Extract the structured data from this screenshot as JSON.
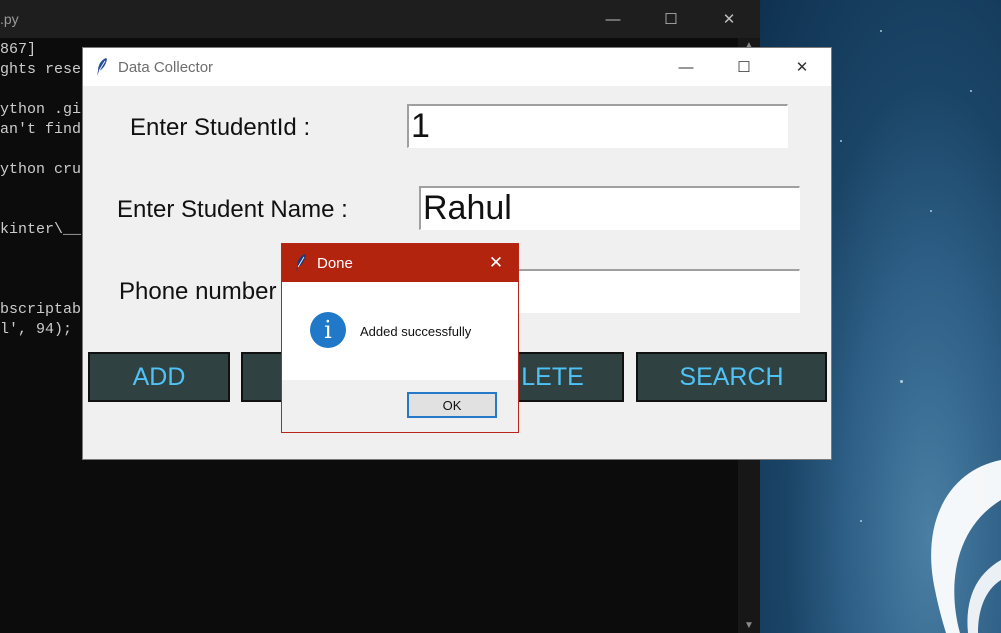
{
  "console": {
    "title": ".py",
    "lines": [
      "867]",
      "ghts rese",
      "",
      "ython .gi",
      "an't find",
      "",
      "ython cru",
      "",
      "",
      "kinter\\__",
      "",
      "",
      "",
      "bscriptab",
      "l', 94);"
    ],
    "minimize": "—",
    "maximize": "☐",
    "close": "✕"
  },
  "app": {
    "title": "Data Collector",
    "minimize": "—",
    "maximize": "☐",
    "close": "✕",
    "labels": {
      "student_id": "Enter StudentId :",
      "student_name": "Enter Student Name :",
      "phone": "Phone number"
    },
    "fields": {
      "student_id": "1",
      "student_name": "Rahul",
      "phone": ""
    },
    "buttons": {
      "add": "ADD",
      "delete_visible": "LETE",
      "search": "SEARCH"
    },
    "colors": {
      "button_bg": "#2f4140",
      "button_text": "#4fc3f7"
    }
  },
  "dialog": {
    "title": "Done",
    "close": "✕",
    "icon": "info-icon",
    "message": "Added successfully",
    "ok": "OK",
    "colors": {
      "titlebar": "#b3240e"
    }
  }
}
